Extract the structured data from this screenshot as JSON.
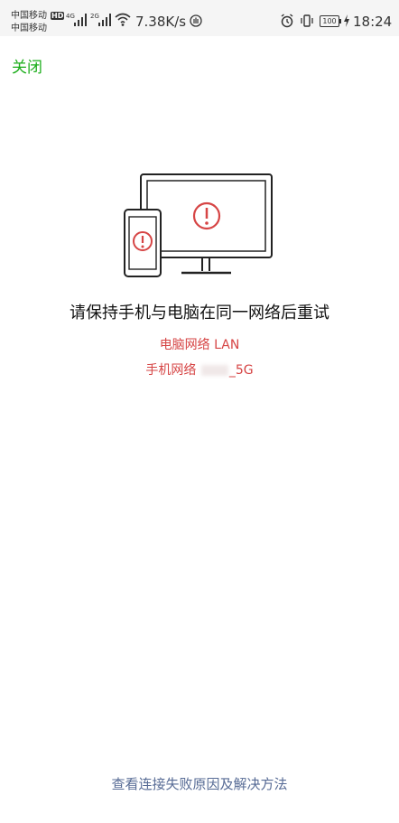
{
  "status_bar": {
    "carrier_1": "中国移动",
    "carrier_2": "中国移动",
    "hd": "HD",
    "net_4g": "4G",
    "net_2g": "2G",
    "speed": "7.38K/s",
    "battery": "100",
    "time": "18:24"
  },
  "header": {
    "close_label": "关闭"
  },
  "main": {
    "message": "请保持手机与电脑在同一网络后重试",
    "pc_network_label": "电脑网络 LAN",
    "phone_network_prefix": "手机网络 ",
    "phone_network_suffix": "_5G"
  },
  "footer": {
    "help_link": "查看连接失败原因及解决方法"
  },
  "colors": {
    "accent_green": "#1aad19",
    "error_red": "#d64545",
    "link_blue": "#576b95"
  }
}
